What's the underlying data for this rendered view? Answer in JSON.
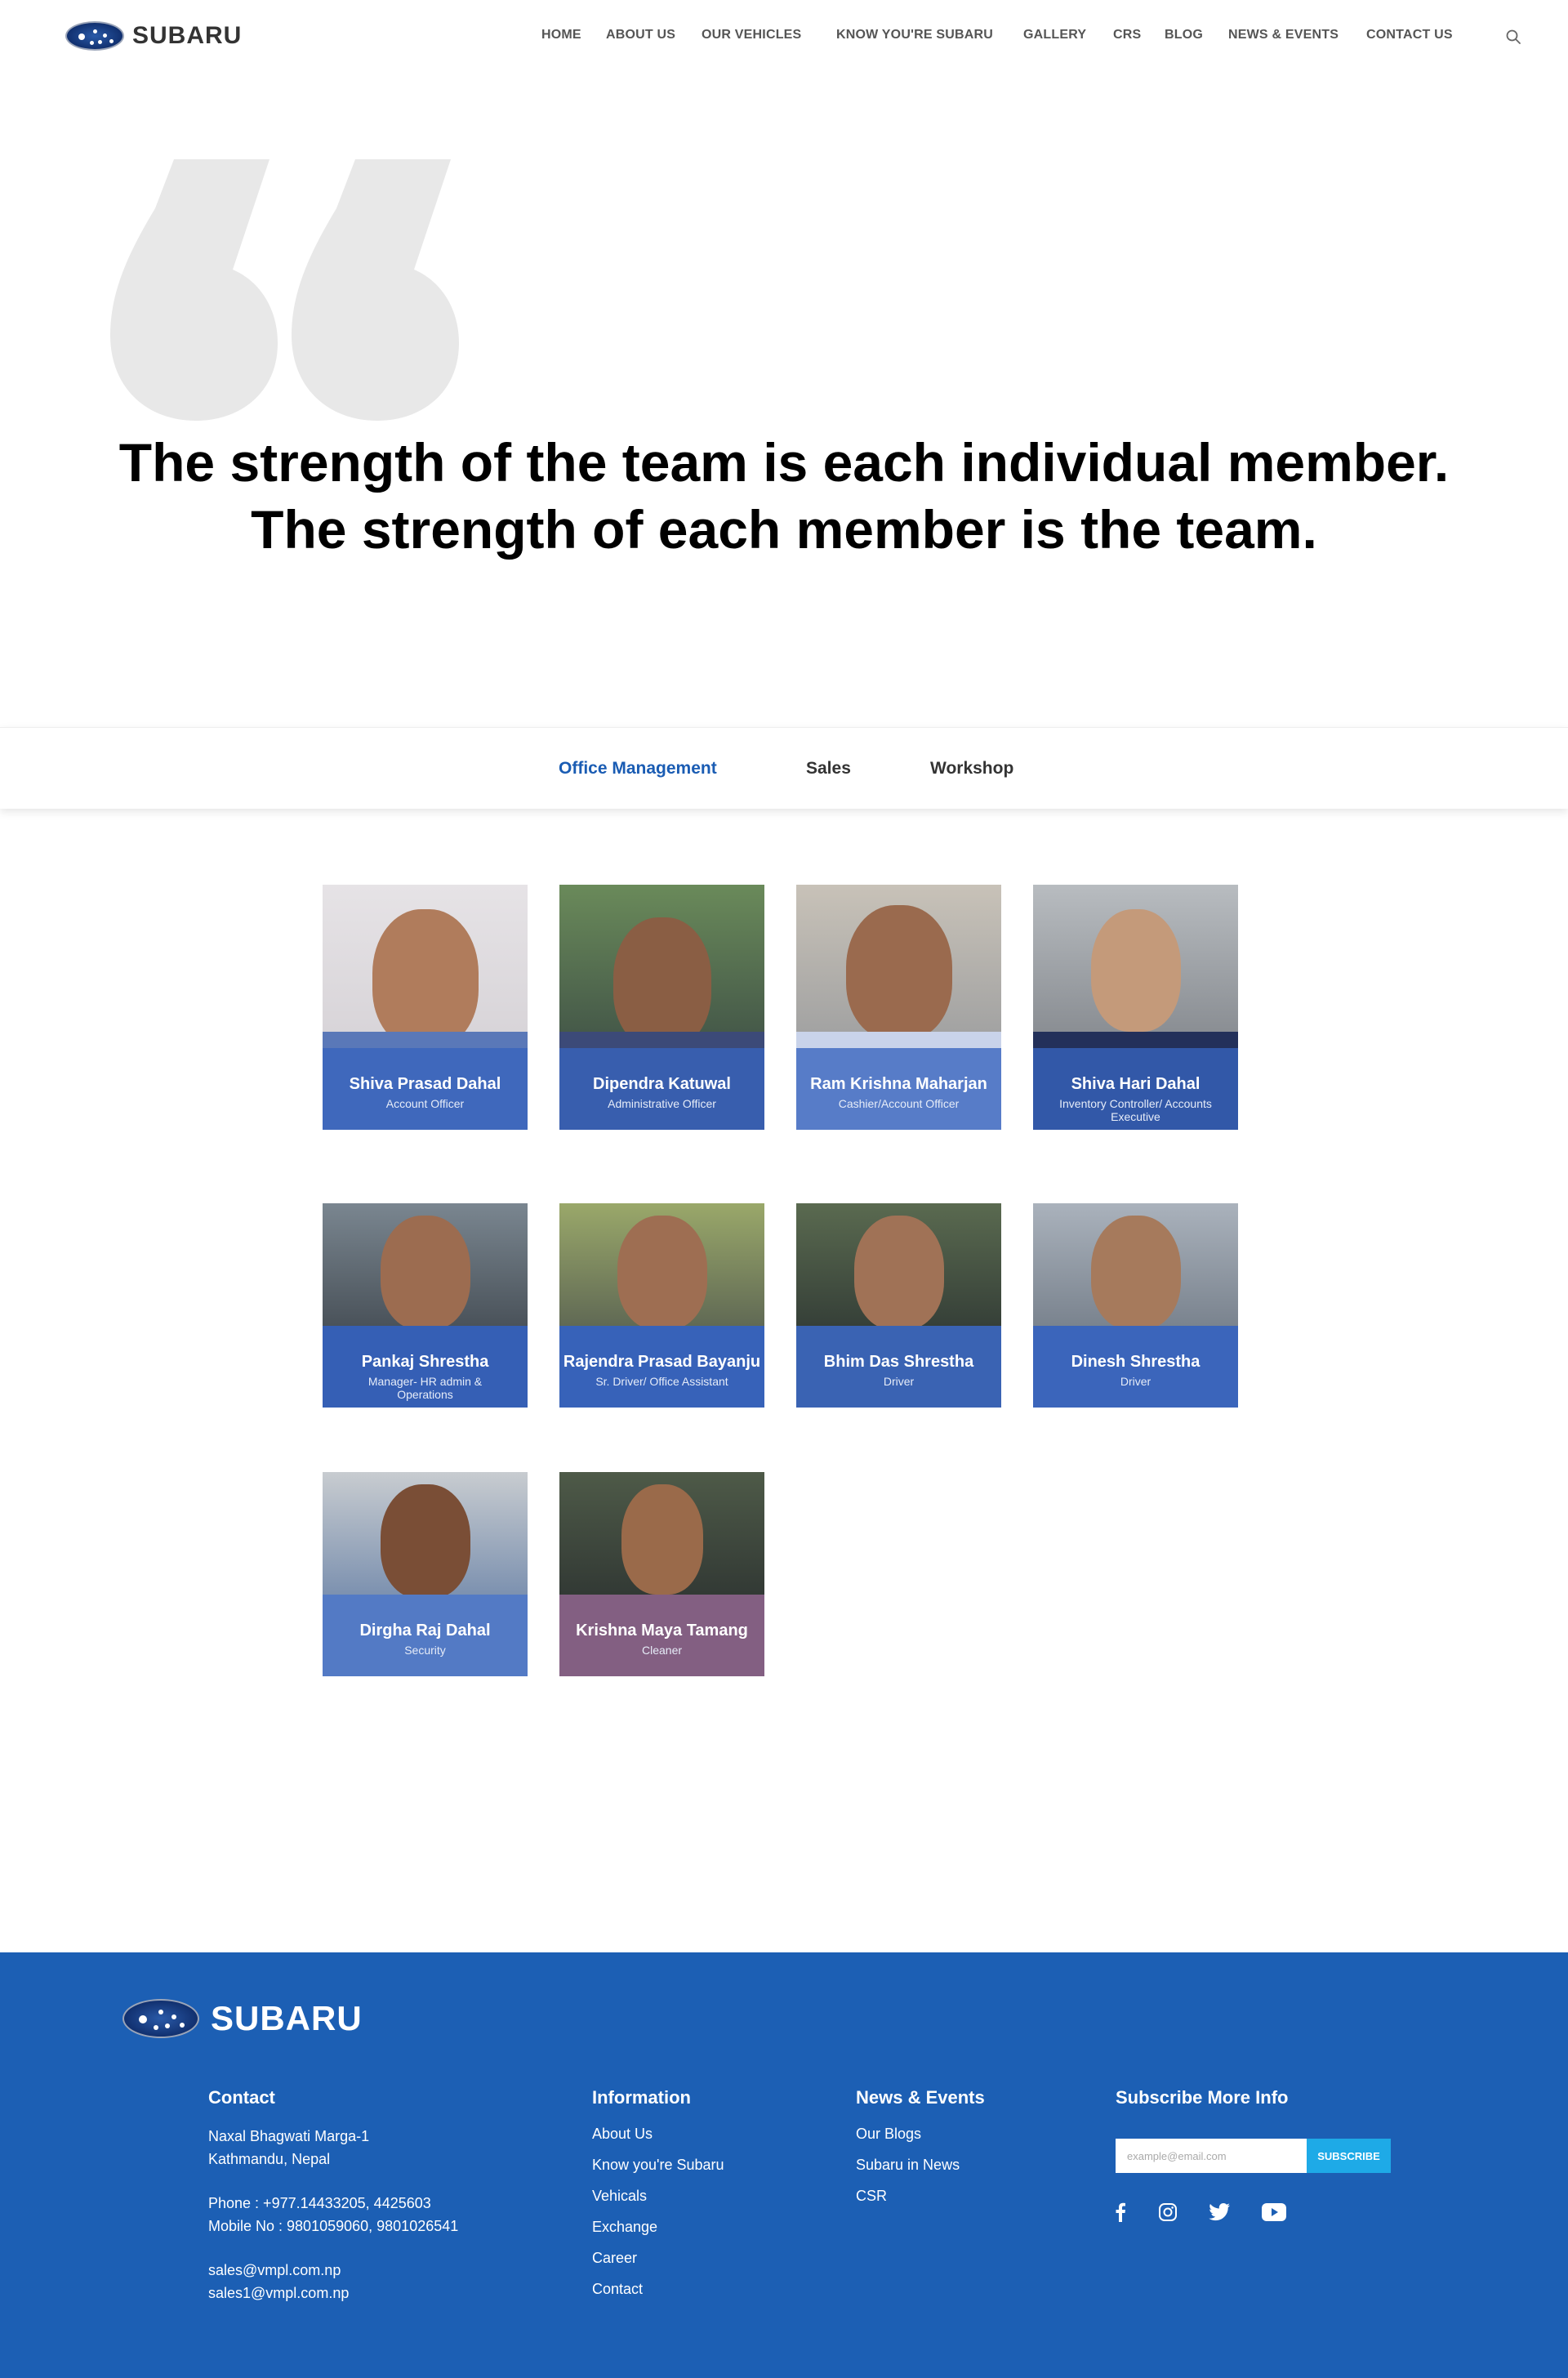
{
  "brand": {
    "name": "SUBARU"
  },
  "nav": {
    "items": [
      "HOME",
      "ABOUT US",
      "OUR VEHICLES",
      "KNOW YOU'RE SUBARU",
      "GALLERY",
      "CRS",
      "BLOG",
      "NEWS & EVENTS",
      "CONTACT US"
    ],
    "search_icon": "search-icon"
  },
  "quote": {
    "icon": "quote-mark-icon",
    "line1": "The strength of the team is each individual member.",
    "line2": "The strength of each member is the team."
  },
  "tabs": {
    "items": [
      "Office Management",
      "Sales",
      "Workshop"
    ],
    "active": "Office Management",
    "active_color": "#1a5cb3"
  },
  "team": [
    {
      "name": "Shiva Prasad Dahal",
      "role": "Account Officer"
    },
    {
      "name": "Dipendra Katuwal",
      "role": "Administrative  Officer"
    },
    {
      "name": "Ram Krishna Maharjan",
      "role": "Cashier/Account Officer"
    },
    {
      "name": "Shiva Hari Dahal",
      "role": "Inventory Controller/ Accounts Executive"
    },
    {
      "name": "Pankaj Shrestha",
      "role": "Manager- HR admin & Operations"
    },
    {
      "name": "Rajendra Prasad Bayanju",
      "role": "Sr. Driver/ Office Assistant"
    },
    {
      "name": "Bhim Das Shrestha",
      "role": "Driver"
    },
    {
      "name": "Dinesh Shrestha",
      "role": "Driver"
    },
    {
      "name": "Dirgha Raj Dahal",
      "role": "Security"
    },
    {
      "name": "Krishna Maya Tamang",
      "role": "Cleaner"
    }
  ],
  "footer": {
    "background": "#1c5fb4",
    "contact": {
      "heading": "Contact",
      "address1": "Naxal Bhagwati Marga-1",
      "address2": "Kathmandu, Nepal",
      "phone": "Phone : +977.14433205, 4425603",
      "mobile": "Mobile No : 9801059060, 9801026541",
      "email1": "sales@vmpl.com.np",
      "email2": "sales1@vmpl.com.np"
    },
    "information": {
      "heading": "Information",
      "links": [
        "About Us",
        "Know you're Subaru",
        "Vehicals",
        "Exchange",
        "Career",
        "Contact"
      ]
    },
    "news": {
      "heading": "News & Events",
      "links": [
        "Our Blogs",
        "Subaru in News",
        "CSR"
      ]
    },
    "subscribe": {
      "heading": "Subscribe More Info",
      "placeholder": "example@email.com",
      "button": "SUBSCRIBE",
      "button_color": "#1eaae7"
    },
    "social_icons": [
      "facebook-icon",
      "instagram-icon",
      "twitter-icon",
      "youtube-icon"
    ]
  }
}
